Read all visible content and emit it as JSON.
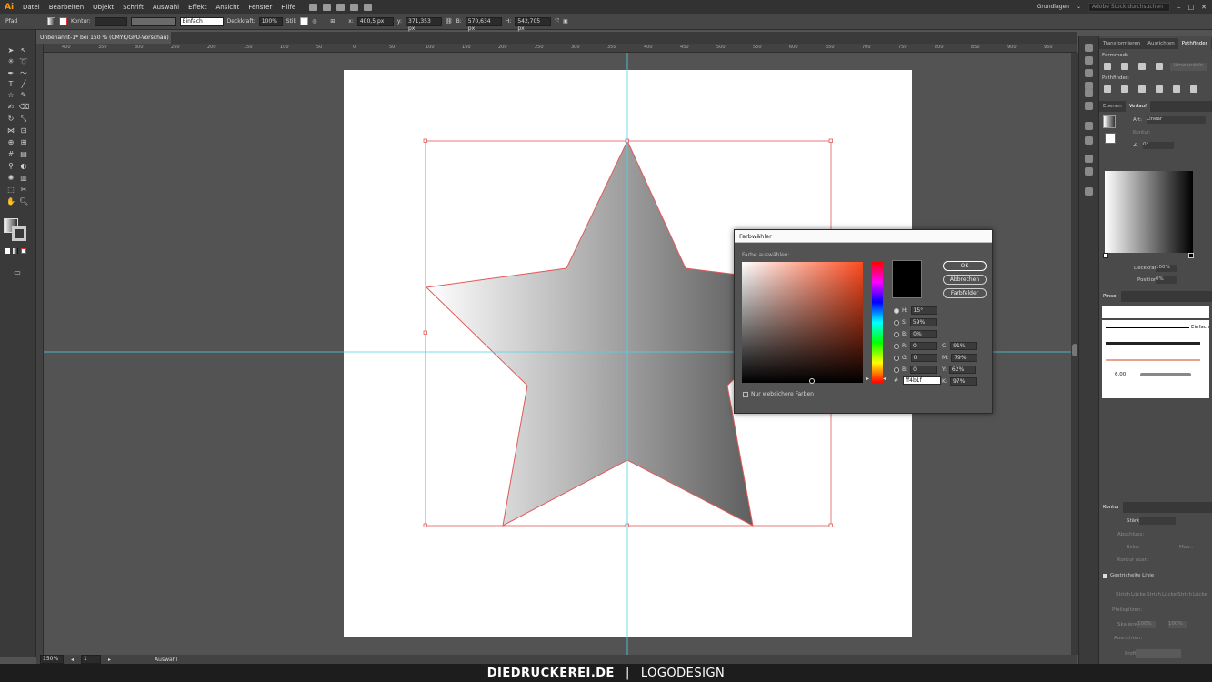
{
  "app": {
    "logo": "Ai",
    "workspace": "Grundlagen",
    "search_placeholder": "Adobe Stock durchsuchen"
  },
  "menu": [
    "Datei",
    "Bearbeiten",
    "Objekt",
    "Schrift",
    "Auswahl",
    "Effekt",
    "Ansicht",
    "Fenster",
    "Hilfe"
  ],
  "control_bar": {
    "tool_name": "Pfad",
    "stroke_label": "Kontur:",
    "stroke_style": "Einfach",
    "opacity_label": "Deckkraft:",
    "opacity_value": "100%",
    "style_label": "Stil:",
    "x_label": "x:",
    "x_value": "400,5 px",
    "y_label": "y:",
    "y_value": "371,353 px",
    "w_label": "B:",
    "w_value": "570,634 px",
    "h_label": "H:",
    "h_value": "542,705 px"
  },
  "document": {
    "tab_title": "Unbenannt-1* bei 150 % (CMYK/GPU-Vorschau)",
    "close_icon": "×"
  },
  "ruler_ticks": [
    "400",
    "350",
    "300",
    "250",
    "200",
    "150",
    "100",
    "50",
    "0",
    "50",
    "100",
    "150",
    "200",
    "250",
    "300",
    "350",
    "400",
    "450",
    "500",
    "550",
    "600",
    "650",
    "700",
    "750",
    "800",
    "850",
    "900",
    "950",
    "1000"
  ],
  "status_bar": {
    "zoom": "150%",
    "artboard": "1",
    "tool": "Auswahl"
  },
  "color_picker": {
    "title": "Farbwähler",
    "prompt": "Farbe auswählen:",
    "buttons": {
      "ok": "OK",
      "cancel": "Abbrechen",
      "swatches": "Farbfelder"
    },
    "hsb": {
      "h_label": "H:",
      "h": "15°",
      "s_label": "S:",
      "s": "59%",
      "b_label": "B:",
      "b": "0%"
    },
    "rgb": {
      "r_label": "R:",
      "r": "0",
      "g_label": "G:",
      "g": "0",
      "b_label": "B:",
      "b": "0"
    },
    "cmyk": {
      "c_label": "C:",
      "c": "91%",
      "m_label": "M:",
      "m": "79%",
      "y_label": "Y:",
      "y": "62%",
      "k_label": "K:",
      "k": "97%"
    },
    "hex_label": "#",
    "hex": "ff4b1f",
    "web_safe_label": "Nur websichere Farben",
    "hue_color": "#ff4b1f",
    "current_color": "#000000"
  },
  "panels": {
    "top_tabs": [
      "Transformieren",
      "Ausrichten",
      "Pathfinder"
    ],
    "shape_modes_label": "Formmodi:",
    "expand_button": "Umwandeln",
    "pathfinder_label": "Pathfinder:",
    "gradient_tabs": [
      "Ebenen",
      "Verlauf"
    ],
    "gradient_type_label": "Art:",
    "gradient_type": "Linear",
    "edge_label": "Kontur:",
    "angle_value": "0°",
    "gradient_opacity_label": "Deckkraft:",
    "gradient_opacity": "100%",
    "position_label": "Position:",
    "position_value": "0%",
    "brush_tab": "Pinsel",
    "brush_basic": "Einfach",
    "brush_size": "6,00",
    "stroke_tab": "Kontur",
    "stroke_weight_label": "Stärke:",
    "cap_label": "Abschluss:",
    "corner_label": "Ecke:",
    "align_label": "Kontur ausr.:",
    "limit_label": "Max.:",
    "dashed_label": "Gestrichelte Linie",
    "dash_labels": [
      "Strich",
      "Lücke",
      "Strich",
      "Lücke",
      "Strich",
      "Lücke"
    ],
    "arrow_label": "Pfeilspitzen:",
    "scale_label": "Skalieren:",
    "scale_a": "100%",
    "scale_b": "100%",
    "align_arrow_label": "Ausrichten:",
    "profile_label": "Profil:"
  },
  "banner": {
    "brand": "DIEDRUCKEREI.DE",
    "separator": "|",
    "topic": "LOGODESIGN"
  },
  "colors": {
    "selection": "#e05a5a",
    "guide": "#4fd3e8",
    "ui_dark": "#323232",
    "canvas": "#535353"
  }
}
